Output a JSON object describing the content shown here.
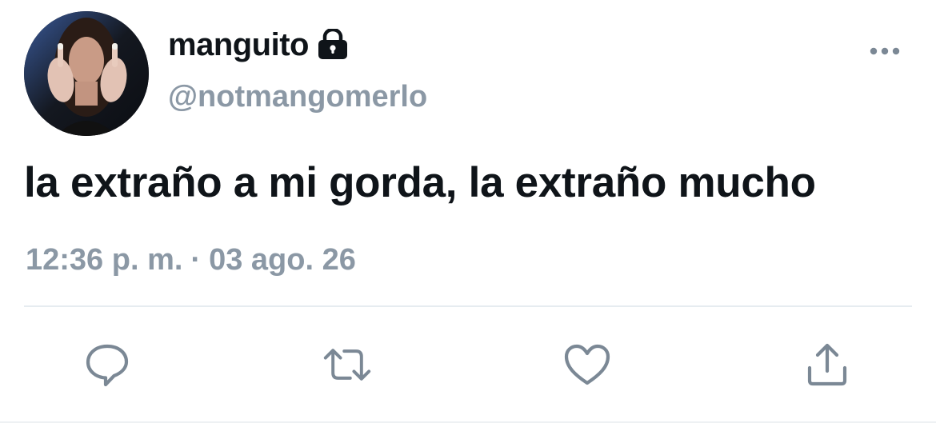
{
  "user": {
    "display_name": "manguito",
    "handle": "@notmangomerlo",
    "protected_icon": "lock-icon",
    "avatar": "profile-photo"
  },
  "tweet": {
    "text": "la extraño a mi gorda, la extraño mucho",
    "time": "12:36 p. m.",
    "separator": "·",
    "date": "03 ago. 26"
  },
  "actions": {
    "reply_icon": "speech-bubble-icon",
    "retweet_icon": "retweet-icon",
    "like_icon": "heart-icon",
    "share_icon": "share-icon"
  },
  "more_icon": "more-options-icon",
  "colors": {
    "text": "#0f1419",
    "secondary": "#8b98a5",
    "icon": "#7b8895",
    "divider": "#e6ecf0"
  }
}
